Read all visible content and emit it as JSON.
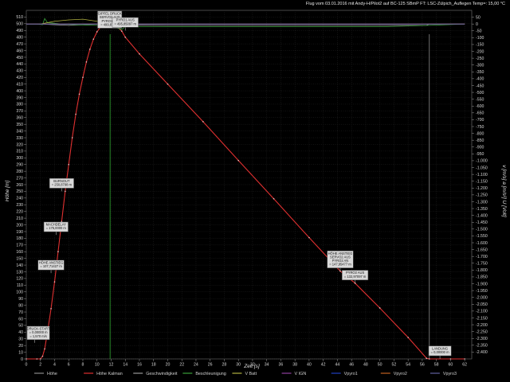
{
  "chart_data": {
    "type": "line",
    "title": "Flug vom 03.01.2016 mit Andy-H/Pilot2 auf BC-125 SBmP FT: LSC-Zülpich_Auflegen Temp=: 15,00 °C",
    "xlabel": "Zeit [s]",
    "ylabel_left": "Höhe [m]",
    "ylabel_right": "v [m/s]  a [m/s²]  U [Volt]",
    "x_range": [
      0,
      63
    ],
    "y_left_range": [
      0,
      520
    ],
    "y_right_range": [
      -2450,
      100
    ],
    "x_ticks": [
      0,
      2,
      4,
      6,
      8,
      10,
      12,
      14,
      16,
      18,
      20,
      22,
      24,
      26,
      28,
      30,
      32,
      34,
      36,
      38,
      40,
      42,
      44,
      46,
      48,
      50,
      52,
      54,
      56,
      58,
      60,
      62
    ],
    "y_left_ticks": [
      0,
      10,
      20,
      30,
      40,
      50,
      60,
      70,
      80,
      90,
      100,
      110,
      120,
      130,
      140,
      150,
      160,
      170,
      180,
      190,
      200,
      210,
      220,
      230,
      240,
      250,
      260,
      270,
      280,
      290,
      300,
      310,
      320,
      330,
      340,
      350,
      360,
      370,
      380,
      390,
      400,
      410,
      420,
      430,
      440,
      450,
      460,
      470,
      480,
      490,
      500,
      510
    ],
    "y_right_ticks": [
      "50",
      "0",
      "-50",
      "-100",
      "-150",
      "-200",
      "-250",
      "-300",
      "-350",
      "-400",
      "-450",
      "-500",
      "-550",
      "-600",
      "-650",
      "-700",
      "-750",
      "-800",
      "-850",
      "-900",
      "-950",
      "-1.000",
      "-1.050",
      "-1.100",
      "-1.150",
      "-1.200",
      "-1.250",
      "-1.300",
      "-1.350",
      "-1.400",
      "-1.450",
      "-1.500",
      "-1.550",
      "-1.600",
      "-1.650",
      "-1.700",
      "-1.750",
      "-1.800",
      "-1.850",
      "-1.900",
      "-1.950",
      "-2.000",
      "-2.050",
      "-2.100",
      "-2.150",
      "-2.200",
      "-2.250",
      "-2.300",
      "-2.350",
      "-2.400"
    ],
    "grid": true,
    "legend_position": "bottom",
    "legend": [
      {
        "name": "Höhe",
        "color": "#8a8a8a"
      },
      {
        "name": "Höhe Kalman",
        "color": "#e03030"
      },
      {
        "name": "Geschwindigkeit",
        "color": "#9a9a9a"
      },
      {
        "name": "Beschleunigung",
        "color": "#3aa03a"
      },
      {
        "name": "V Batt",
        "color": "#b0b040"
      },
      {
        "name": "V IGN",
        "color": "#9040a0"
      },
      {
        "name": "Vpyro1",
        "color": "#2040c0"
      },
      {
        "name": "Vpyro2",
        "color": "#c06020"
      },
      {
        "name": "Vpyro3",
        "color": "#6060a0"
      }
    ],
    "series": [
      {
        "name": "Höhe Kalman",
        "axis": "left",
        "color": "#e03030",
        "x": [
          0,
          1.5,
          2.0,
          2.3,
          2.6,
          3.0,
          3.5,
          4.0,
          4.5,
          5.0,
          5.5,
          6.0,
          6.5,
          7.0,
          7.5,
          8.0,
          8.5,
          9.0,
          9.5,
          10.0,
          10.5,
          11.0,
          11.5,
          12.0,
          12.5,
          13.0,
          13.5,
          14.0,
          16.0,
          20.0,
          25.0,
          30.0,
          35.0,
          40.0,
          44.4,
          46.5,
          50.0,
          54.0,
          56.6,
          57.0,
          60.0,
          62.0
        ],
        "y": [
          0,
          0,
          0,
          4,
          15,
          40,
          75,
          115,
          160,
          205,
          250,
          290,
          330,
          365,
          395,
          420,
          443,
          462,
          477,
          488,
          495,
          499,
          500,
          500,
          498,
          494,
          489,
          480,
          455,
          410,
          354,
          296,
          239,
          181,
          131,
          113,
          76,
          32,
          1,
          0,
          0,
          0
        ]
      },
      {
        "name": "Geschwindigkeit",
        "axis": "right",
        "color": "#9a9a9a",
        "x": [
          0,
          2,
          4,
          6,
          8,
          10,
          12,
          14,
          20,
          30,
          40,
          50,
          56.6,
          57,
          62
        ],
        "y": [
          0,
          0,
          -5,
          -10,
          -5,
          0,
          0,
          -8,
          -10,
          -10,
          -10,
          -10,
          -10,
          0,
          0
        ]
      },
      {
        "name": "Beschleunigung",
        "axis": "right",
        "color": "#3aa03a",
        "x": [
          0,
          1.5,
          2.3,
          2.6,
          3.0,
          4.0,
          5.0,
          7.0,
          10.0,
          12.0,
          13.5,
          14.0,
          20.0,
          30.0,
          40.0,
          50.0,
          57.0,
          62.0
        ],
        "y": [
          0,
          0,
          -5,
          40,
          10,
          5,
          0,
          -5,
          -10,
          -15,
          -40,
          -20,
          -20,
          -20,
          -20,
          -20,
          -10,
          0
        ]
      },
      {
        "name": "V Batt",
        "axis": "right",
        "color": "#b0b040",
        "x": [
          0,
          2,
          4,
          6,
          8,
          10,
          12,
          14,
          20,
          30,
          40,
          50,
          56.6,
          57,
          62
        ],
        "y": [
          0,
          0,
          20,
          30,
          35,
          20,
          5,
          0,
          0,
          0,
          0,
          0,
          0,
          0,
          0
        ]
      },
      {
        "name": "V IGN",
        "axis": "right",
        "color": "#9040a0",
        "x": [
          0,
          62
        ],
        "y": [
          0,
          0
        ]
      },
      {
        "name": "Vpyro1",
        "axis": "right",
        "color": "#2040c0",
        "x": [
          0,
          62
        ],
        "y": [
          0,
          0
        ]
      },
      {
        "name": "Vpyro2",
        "axis": "right",
        "color": "#c06020",
        "x": [
          0,
          62
        ],
        "y": [
          0,
          0
        ]
      },
      {
        "name": "Vpyro3",
        "axis": "right",
        "color": "#6060a0",
        "x": [
          0,
          62
        ],
        "y": [
          0,
          0
        ]
      }
    ],
    "markers": [
      {
        "name": "apogee-marker",
        "x": 11.85,
        "color": "#2ea82e"
      },
      {
        "name": "landing-marker",
        "x": 57.0,
        "color": "#888888"
      }
    ],
    "annotations": [
      {
        "id": "druckstart",
        "x": 1.2,
        "y": 24,
        "lines": [
          "DRUCK-START",
          "= 0,00000 m",
          "= 1,570 m/s"
        ]
      },
      {
        "id": "hoehe-anstieg-1",
        "x": 3.5,
        "y": 128,
        "lines": [
          "HÖHE ANSTIEG",
          "= 107,71427 m"
        ]
      },
      {
        "id": "machdelay",
        "x": 4.2,
        "y": 185,
        "lines": [
          "MACHDELAY",
          "= 175,0000 m"
        ]
      },
      {
        "id": "burnout",
        "x": 5.0,
        "y": 250,
        "lines": [
          "BURNOUT",
          "= 250,8798 m"
        ]
      },
      {
        "id": "gipfel",
        "x": 11.8,
        "y": 500,
        "lines": [
          "GIPFEL DRUCK",
          "SERVO2 AUS",
          "PYRO1 AN",
          "= 499,871 m"
        ]
      },
      {
        "id": "pyro2-aus-top",
        "x": 14.0,
        "y": 490,
        "lines": [
          "PYRO1 AUS",
          "= 495,85097 m"
        ]
      },
      {
        "id": "hoehe-anstieg-2",
        "x": 44.4,
        "y": 131,
        "lines": [
          "HÖHE ANSTIEG",
          "SERVO2 AUS",
          "PYRO2 AN",
          "= 147,95477 m"
        ]
      },
      {
        "id": "pyro2-aus",
        "x": 46.5,
        "y": 113,
        "lines": [
          "PYRO2 AUS",
          "= 132,97097 m"
        ]
      },
      {
        "id": "landung",
        "x": 58.5,
        "y": 0,
        "lines": [
          "LANDUNG",
          "= 0,00000 m"
        ]
      }
    ]
  }
}
